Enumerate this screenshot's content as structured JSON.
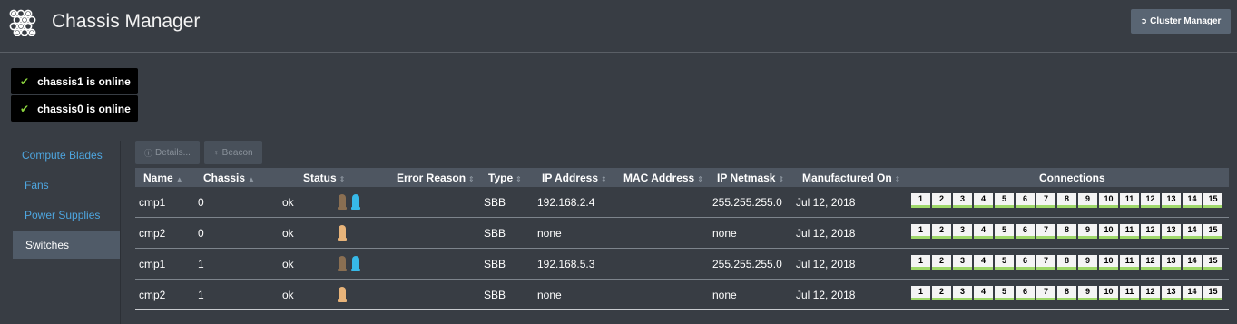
{
  "header": {
    "title": "Chassis Manager",
    "cluster_button": "Cluster Manager",
    "cluster_icon": "arrow-circle-icon"
  },
  "notifications": [
    {
      "text": "chassis1 is online",
      "icon": "check-icon"
    },
    {
      "text": "chassis0 is online",
      "icon": "check-icon"
    }
  ],
  "sidebar": {
    "items": [
      {
        "label": "Compute Blades",
        "active": false
      },
      {
        "label": "Fans",
        "active": false
      },
      {
        "label": "Power Supplies",
        "active": false
      },
      {
        "label": "Switches",
        "active": true
      }
    ]
  },
  "toolbar": {
    "details_label": "Details...",
    "beacon_label": "Beacon"
  },
  "table": {
    "columns": [
      "Name",
      "Chassis",
      "Status",
      "Error Reason",
      "Type",
      "IP Address",
      "MAC Address",
      "IP Netmask",
      "Manufactured On",
      "Connections"
    ],
    "rows": [
      {
        "name": "cmp1",
        "chassis": "0",
        "status": "ok",
        "error": "",
        "type": "SBB",
        "ip": "192.168.2.4",
        "mac": "",
        "netmask": "255.255.255.0",
        "manufactured": "Jul 12, 2018",
        "leds": [
          "amber-dim",
          "blue"
        ]
      },
      {
        "name": "cmp2",
        "chassis": "0",
        "status": "ok",
        "error": "",
        "type": "SBB",
        "ip": "none",
        "mac": "",
        "netmask": "none",
        "manufactured": "Jul 12, 2018",
        "leds": [
          "amber"
        ]
      },
      {
        "name": "cmp1",
        "chassis": "1",
        "status": "ok",
        "error": "",
        "type": "SBB",
        "ip": "192.168.5.3",
        "mac": "",
        "netmask": "255.255.255.0",
        "manufactured": "Jul 12, 2018",
        "leds": [
          "amber-dim",
          "blue"
        ]
      },
      {
        "name": "cmp2",
        "chassis": "1",
        "status": "ok",
        "error": "",
        "type": "SBB",
        "ip": "none",
        "mac": "",
        "netmask": "none",
        "manufactured": "Jul 12, 2018",
        "leds": [
          "amber"
        ]
      }
    ],
    "ports": [
      "1",
      "2",
      "3",
      "4",
      "5",
      "6",
      "7",
      "8",
      "9",
      "10",
      "11",
      "12",
      "13",
      "14",
      "15"
    ]
  },
  "colors": {
    "background": "#383d44",
    "link": "#4ea6e0",
    "success": "#8bd33e",
    "port_link": "#9fd86a"
  }
}
